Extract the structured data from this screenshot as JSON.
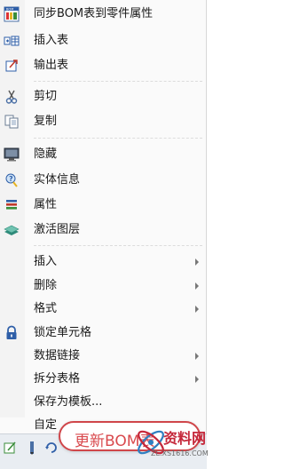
{
  "menu": {
    "items": [
      {
        "label": "同步BOM表到零件属性",
        "icon": "bom-sync-icon",
        "submenu": false
      },
      {
        "label": "插入表",
        "icon": "insert-table-icon",
        "submenu": false
      },
      {
        "label": "输出表",
        "icon": "export-table-icon",
        "submenu": false
      },
      {
        "label": "剪切",
        "icon": "scissors-icon",
        "submenu": false
      },
      {
        "label": "复制",
        "icon": "copy-icon",
        "submenu": false
      },
      {
        "label": "隐藏",
        "icon": "hide-monitor-icon",
        "submenu": false
      },
      {
        "label": "实体信息",
        "icon": "entity-info-icon",
        "submenu": false
      },
      {
        "label": "属性",
        "icon": "properties-icon",
        "submenu": false
      },
      {
        "label": "激活图层",
        "icon": "layers-icon",
        "submenu": false
      },
      {
        "label": "插入",
        "icon": "",
        "submenu": true
      },
      {
        "label": "删除",
        "icon": "",
        "submenu": true
      },
      {
        "label": "格式",
        "icon": "",
        "submenu": true
      },
      {
        "label": "锁定单元格",
        "icon": "lock-icon",
        "submenu": false
      },
      {
        "label": "数据链接",
        "icon": "",
        "submenu": true
      },
      {
        "label": "拆分表格",
        "icon": "",
        "submenu": true
      },
      {
        "label": "保存为模板...",
        "icon": "",
        "submenu": false
      },
      {
        "label": "自定",
        "icon": "",
        "submenu": false
      }
    ],
    "update_callout": "更新BOM表"
  },
  "watermark": {
    "brand": "资料网",
    "url": "ZL.XS1616.COM"
  },
  "colors": {
    "accent_red": "#d94a4e",
    "menu_bg": "#fafafa"
  }
}
